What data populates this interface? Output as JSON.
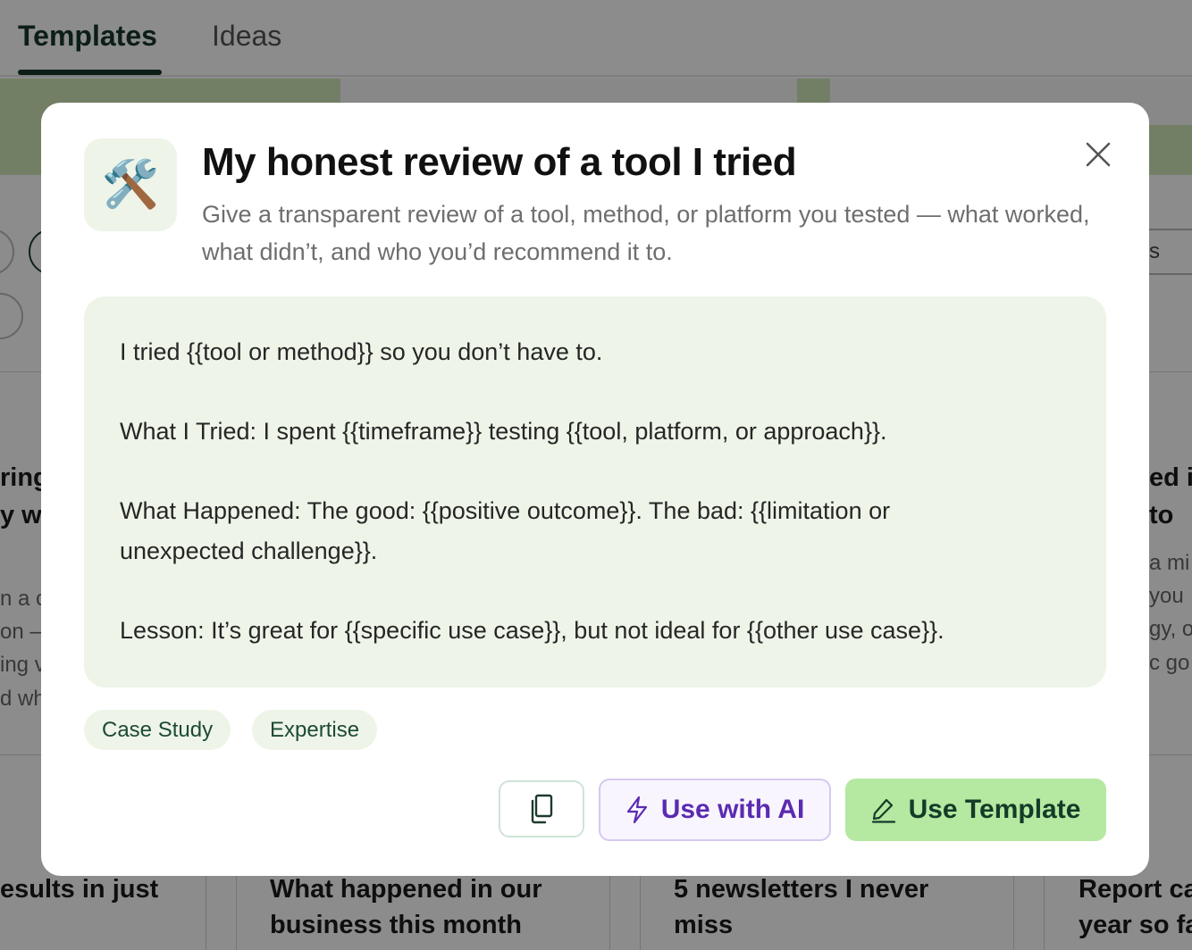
{
  "background": {
    "tabs": [
      {
        "label": "Templates",
        "active": true
      },
      {
        "label": "Ideas",
        "active": false
      }
    ],
    "filter_chip_partial": "s",
    "cards_row1": [
      {
        "title_lines": [
          "ring",
          "y w"
        ],
        "desc_lines": [
          "n a c",
          "on –",
          "ing v",
          "d wh"
        ]
      },
      {
        "title_lines": [
          "ed i",
          "to"
        ],
        "desc_lines": [
          "a mi",
          "you",
          "gy, o",
          "c go"
        ]
      }
    ],
    "cards_row2": [
      {
        "title_lines": [
          "esults in just"
        ]
      },
      {
        "title_lines": [
          "What happened in our",
          "business this month"
        ]
      },
      {
        "title_lines": [
          "5 newsletters I never",
          "miss"
        ]
      },
      {
        "title_lines": [
          "Report ca",
          "year so fa"
        ]
      }
    ]
  },
  "modal": {
    "icon": "hammer-and-wrench-icon",
    "icon_glyph": "🛠️",
    "title": "My honest review of a tool I tried",
    "description": "Give a transparent review of a tool, method, or platform you tested — what worked, what didn’t, and who you’d recommend it to.",
    "template_lines": [
      "I tried {{tool or method}} so you don’t have to.",
      "What I Tried: I spent {{timeframe}} testing {{tool, platform, or approach}}.",
      "What Happened: The good: {{positive outcome}}. The bad: {{limitation or",
      "unexpected challenge}}.",
      "Lesson: It’s great for {{specific use case}}, but not ideal for {{other use case}}."
    ],
    "tags": [
      "Case Study",
      "Expertise"
    ],
    "buttons": {
      "use_with_ai": "Use with AI",
      "use_template": "Use Template"
    }
  },
  "colors": {
    "accent_green": "#b5e8a0",
    "dark_green": "#16382a",
    "ai_purple": "#5b2bb0",
    "template_bg": "#eef5e8"
  }
}
